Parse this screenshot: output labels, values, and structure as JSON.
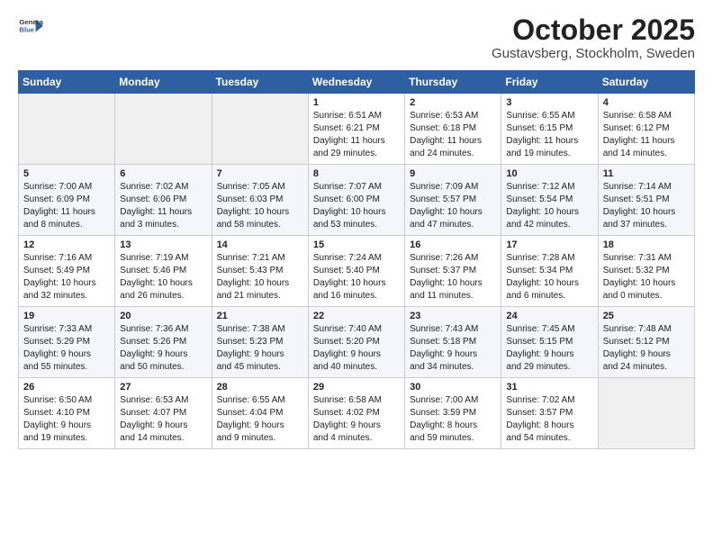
{
  "header": {
    "logo_line1": "General",
    "logo_line2": "Blue",
    "month_title": "October 2025",
    "subtitle": "Gustavsberg, Stockholm, Sweden"
  },
  "weekdays": [
    "Sunday",
    "Monday",
    "Tuesday",
    "Wednesday",
    "Thursday",
    "Friday",
    "Saturday"
  ],
  "weeks": [
    [
      {
        "day": "",
        "info": ""
      },
      {
        "day": "",
        "info": ""
      },
      {
        "day": "",
        "info": ""
      },
      {
        "day": "1",
        "info": "Sunrise: 6:51 AM\nSunset: 6:21 PM\nDaylight: 11 hours\nand 29 minutes."
      },
      {
        "day": "2",
        "info": "Sunrise: 6:53 AM\nSunset: 6:18 PM\nDaylight: 11 hours\nand 24 minutes."
      },
      {
        "day": "3",
        "info": "Sunrise: 6:55 AM\nSunset: 6:15 PM\nDaylight: 11 hours\nand 19 minutes."
      },
      {
        "day": "4",
        "info": "Sunrise: 6:58 AM\nSunset: 6:12 PM\nDaylight: 11 hours\nand 14 minutes."
      }
    ],
    [
      {
        "day": "5",
        "info": "Sunrise: 7:00 AM\nSunset: 6:09 PM\nDaylight: 11 hours\nand 8 minutes."
      },
      {
        "day": "6",
        "info": "Sunrise: 7:02 AM\nSunset: 6:06 PM\nDaylight: 11 hours\nand 3 minutes."
      },
      {
        "day": "7",
        "info": "Sunrise: 7:05 AM\nSunset: 6:03 PM\nDaylight: 10 hours\nand 58 minutes."
      },
      {
        "day": "8",
        "info": "Sunrise: 7:07 AM\nSunset: 6:00 PM\nDaylight: 10 hours\nand 53 minutes."
      },
      {
        "day": "9",
        "info": "Sunrise: 7:09 AM\nSunset: 5:57 PM\nDaylight: 10 hours\nand 47 minutes."
      },
      {
        "day": "10",
        "info": "Sunrise: 7:12 AM\nSunset: 5:54 PM\nDaylight: 10 hours\nand 42 minutes."
      },
      {
        "day": "11",
        "info": "Sunrise: 7:14 AM\nSunset: 5:51 PM\nDaylight: 10 hours\nand 37 minutes."
      }
    ],
    [
      {
        "day": "12",
        "info": "Sunrise: 7:16 AM\nSunset: 5:49 PM\nDaylight: 10 hours\nand 32 minutes."
      },
      {
        "day": "13",
        "info": "Sunrise: 7:19 AM\nSunset: 5:46 PM\nDaylight: 10 hours\nand 26 minutes."
      },
      {
        "day": "14",
        "info": "Sunrise: 7:21 AM\nSunset: 5:43 PM\nDaylight: 10 hours\nand 21 minutes."
      },
      {
        "day": "15",
        "info": "Sunrise: 7:24 AM\nSunset: 5:40 PM\nDaylight: 10 hours\nand 16 minutes."
      },
      {
        "day": "16",
        "info": "Sunrise: 7:26 AM\nSunset: 5:37 PM\nDaylight: 10 hours\nand 11 minutes."
      },
      {
        "day": "17",
        "info": "Sunrise: 7:28 AM\nSunset: 5:34 PM\nDaylight: 10 hours\nand 6 minutes."
      },
      {
        "day": "18",
        "info": "Sunrise: 7:31 AM\nSunset: 5:32 PM\nDaylight: 10 hours\nand 0 minutes."
      }
    ],
    [
      {
        "day": "19",
        "info": "Sunrise: 7:33 AM\nSunset: 5:29 PM\nDaylight: 9 hours\nand 55 minutes."
      },
      {
        "day": "20",
        "info": "Sunrise: 7:36 AM\nSunset: 5:26 PM\nDaylight: 9 hours\nand 50 minutes."
      },
      {
        "day": "21",
        "info": "Sunrise: 7:38 AM\nSunset: 5:23 PM\nDaylight: 9 hours\nand 45 minutes."
      },
      {
        "day": "22",
        "info": "Sunrise: 7:40 AM\nSunset: 5:20 PM\nDaylight: 9 hours\nand 40 minutes."
      },
      {
        "day": "23",
        "info": "Sunrise: 7:43 AM\nSunset: 5:18 PM\nDaylight: 9 hours\nand 34 minutes."
      },
      {
        "day": "24",
        "info": "Sunrise: 7:45 AM\nSunset: 5:15 PM\nDaylight: 9 hours\nand 29 minutes."
      },
      {
        "day": "25",
        "info": "Sunrise: 7:48 AM\nSunset: 5:12 PM\nDaylight: 9 hours\nand 24 minutes."
      }
    ],
    [
      {
        "day": "26",
        "info": "Sunrise: 6:50 AM\nSunset: 4:10 PM\nDaylight: 9 hours\nand 19 minutes."
      },
      {
        "day": "27",
        "info": "Sunrise: 6:53 AM\nSunset: 4:07 PM\nDaylight: 9 hours\nand 14 minutes."
      },
      {
        "day": "28",
        "info": "Sunrise: 6:55 AM\nSunset: 4:04 PM\nDaylight: 9 hours\nand 9 minutes."
      },
      {
        "day": "29",
        "info": "Sunrise: 6:58 AM\nSunset: 4:02 PM\nDaylight: 9 hours\nand 4 minutes."
      },
      {
        "day": "30",
        "info": "Sunrise: 7:00 AM\nSunset: 3:59 PM\nDaylight: 8 hours\nand 59 minutes."
      },
      {
        "day": "31",
        "info": "Sunrise: 7:02 AM\nSunset: 3:57 PM\nDaylight: 8 hours\nand 54 minutes."
      },
      {
        "day": "",
        "info": ""
      }
    ]
  ]
}
